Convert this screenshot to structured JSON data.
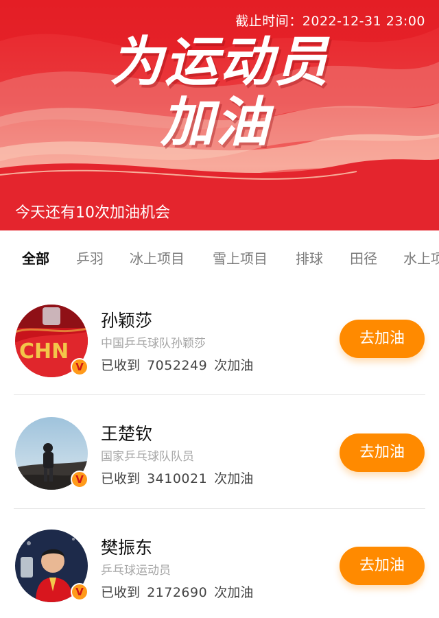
{
  "banner": {
    "deadline": "截止时间：2022-12-31 23:00",
    "headline_line1": "为运动员",
    "headline_line2": "加油",
    "chances_text": "今天还有10次加油机会"
  },
  "tabs": [
    {
      "label": "全部",
      "active": true
    },
    {
      "label": "乒羽",
      "active": false
    },
    {
      "label": "冰上项目",
      "active": false
    },
    {
      "label": "雪上项目",
      "active": false
    },
    {
      "label": "排球",
      "active": false
    },
    {
      "label": "田径",
      "active": false
    },
    {
      "label": "水上项目",
      "active": false
    }
  ],
  "athletes": [
    {
      "name": "孙颖莎",
      "desc": "中国乒乓球队孙颖莎",
      "received_label": "已收到",
      "count": "7052249",
      "count_suffix": "次加油",
      "button_label": "去加油",
      "verified_mark": "V"
    },
    {
      "name": "王楚钦",
      "desc": "国家乒乓球队队员",
      "received_label": "已收到",
      "count": "3410021",
      "count_suffix": "次加油",
      "button_label": "去加油",
      "verified_mark": "V"
    },
    {
      "name": "樊振东",
      "desc": "乒乓球运动员",
      "received_label": "已收到",
      "count": "2172690",
      "count_suffix": "次加油",
      "button_label": "去加油",
      "verified_mark": "V"
    }
  ],
  "colors": {
    "banner_red": "#e8232a",
    "button_orange": "#ff8a00",
    "verified_orange": "#ff9a1a"
  }
}
